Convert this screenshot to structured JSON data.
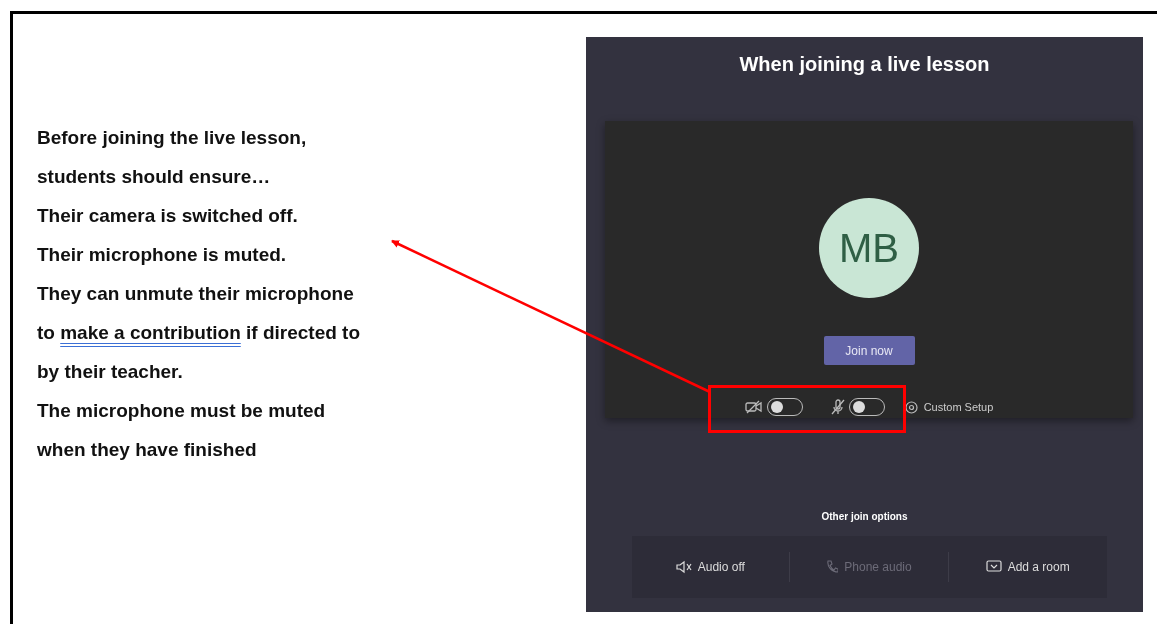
{
  "instructions": [
    {
      "parts": [
        {
          "text": "Before joining the live lesson,",
          "underlined": false
        }
      ]
    },
    {
      "parts": [
        {
          "text": "students should ensure…",
          "underlined": false
        }
      ]
    },
    {
      "parts": [
        {
          "text": "Their camera is switched off.",
          "underlined": false
        }
      ]
    },
    {
      "parts": [
        {
          "text": "Their microphone is muted.",
          "underlined": false
        }
      ]
    },
    {
      "parts": [
        {
          "text": "They can unmute their microphone",
          "underlined": false
        }
      ]
    },
    {
      "parts": [
        {
          "text": "to ",
          "underlined": false
        },
        {
          "text": "make a contribution",
          "underlined": true
        },
        {
          "text": " if directed to",
          "underlined": false
        }
      ]
    },
    {
      "parts": [
        {
          "text": "by their teacher.",
          "underlined": false
        }
      ]
    },
    {
      "parts": [
        {
          "text": "The microphone must be muted",
          "underlined": false
        }
      ]
    },
    {
      "parts": [
        {
          "text": "when they have finished",
          "underlined": false
        }
      ]
    }
  ],
  "screenshot": {
    "title": "When joining a live lesson",
    "avatar": {
      "initials": "MB"
    },
    "join_button": "Join now",
    "toggles": [
      {
        "kind": "camera",
        "on": false
      },
      {
        "kind": "microphone",
        "on": false
      }
    ],
    "custom_setup": "Custom Setup",
    "other_options_heading": "Other join options",
    "other_options": [
      {
        "kind": "audio-off",
        "label": "Audio off",
        "disabled": false
      },
      {
        "kind": "phone",
        "label": "Phone audio",
        "disabled": true
      },
      {
        "kind": "room",
        "label": "Add a room",
        "disabled": false
      }
    ]
  }
}
